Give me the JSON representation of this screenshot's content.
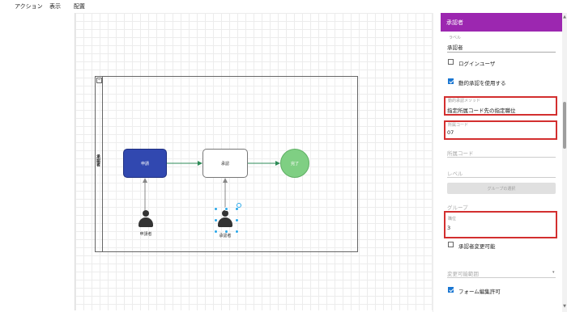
{
  "menu": {
    "items": [
      "アクション",
      "表示",
      "配置"
    ]
  },
  "diagram": {
    "lane_label": "承認者",
    "lane_toggle": "−",
    "nodes": {
      "apply": "申請",
      "approve": "承認",
      "end": "完了"
    },
    "actors": {
      "applicant": "申請者",
      "approver": "承認者"
    },
    "colors": {
      "apply_fill": "#3148b0",
      "end_fill": "#7fcf83",
      "edge": "#2e8b57",
      "assoc": "#888888"
    }
  },
  "panel": {
    "title": "承認者",
    "accent": "#9c27b0",
    "label_caption": "ラベル",
    "label_value": "承認者",
    "login_user_label": "ログインユーザ",
    "login_user_checked": false,
    "dynamic_label": "動的承認を使用する",
    "dynamic_checked": true,
    "method_caption": "動的承認メソッド",
    "method_value": "指定所属コード先の指定職位",
    "code_caption": "所属コード",
    "code_value": "07",
    "dept_code_placeholder": "所属コード",
    "level_placeholder": "レベル",
    "group_button": "グループの選択",
    "group_caption": "グループ",
    "position_caption": "職位",
    "position_value": "3",
    "changeable_label": "承認者変更可能",
    "changeable_checked": false,
    "change_range_placeholder": "変更可能範囲",
    "form_edit_label": "フォーム編集許可",
    "form_edit_checked": true,
    "highlight_color": "#d32f2f"
  },
  "scrollbar": {
    "up": "▲",
    "down": "▼"
  }
}
